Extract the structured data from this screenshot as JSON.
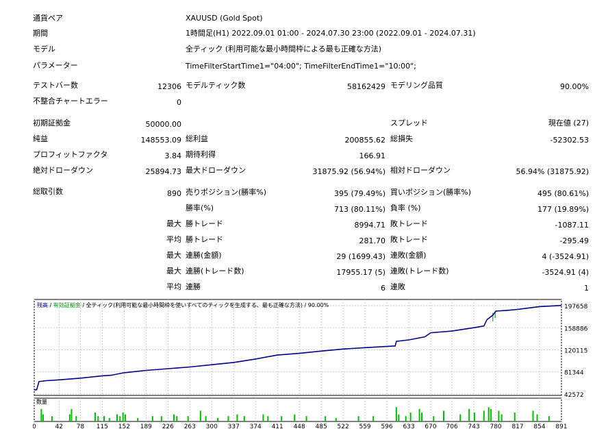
{
  "header": {
    "symbol_label": "通貨ペア",
    "symbol_value": "XAUUSD (Gold Spot)",
    "period_label": "期間",
    "period_value": "1時間足(H1) 2022.09.01 01:00 - 2024.07.30 23:00 (2022.09.01 - 2024.07.31)",
    "model_label": "モデル",
    "model_value": "全ティック (利用可能な最小時間枠による最も正確な方法)",
    "params_label": "パラメーター",
    "params_value": "TimeFilterStartTime1=\"04:00\"; TimeFilterEndTime1=\"10:00\";"
  },
  "stats": {
    "bars_label": "テストバー数",
    "bars_value": "12306",
    "ticks_label": "モデルティック数",
    "ticks_value": "58162429",
    "quality_label": "モデリング品質",
    "quality_value": "90.00%",
    "mismatch_label": "不整合チャートエラー",
    "mismatch_value": "0",
    "deposit_label": "初期証拠金",
    "deposit_value": "50000.00",
    "spread_label": "スプレッド",
    "spread_value": "現在値 (27)",
    "net_label": "純益",
    "net_value": "148553.09",
    "gross_profit_label": "総利益",
    "gross_profit_value": "200855.62",
    "gross_loss_label": "総損失",
    "gross_loss_value": "-52302.53",
    "pf_label": "プロフィットファクタ",
    "pf_value": "3.84",
    "expected_label": "期待利得",
    "expected_value": "166.91",
    "abs_dd_label": "絶対ドローダウン",
    "abs_dd_value": "25894.73",
    "max_dd_label": "最大ドローダウン",
    "max_dd_value": "31875.92 (56.94%)",
    "rel_dd_label": "相対ドローダウン",
    "rel_dd_value": "56.94% (31875.92)",
    "trades_label": "総取引数",
    "trades_value": "890",
    "short_label": "売りポジション(勝率%)",
    "short_value": "395 (79.49%)",
    "long_label": "買いポジション(勝率%)",
    "long_value": "495 (80.61%)",
    "win_rate_label": "勝率(%)",
    "win_rate_value": "713 (80.11%)",
    "loss_rate_label": "負率 (%)",
    "loss_rate_value": "177 (19.89%)",
    "max_prefix": "最大",
    "avg_prefix": "平均",
    "win_trade_label": "勝トレード",
    "loss_trade_label": "敗トレード",
    "largest_win_value": "8994.71",
    "largest_loss_value": "-1087.11",
    "avg_win_value": "281.70",
    "avg_loss_value": "-295.49",
    "max_cons_amount_label": "連勝(金額)",
    "max_cons_amount_value": "29 (1699.43)",
    "max_cons_loss_amount_label": "連敗(金額)",
    "max_cons_loss_amount_value": "4 (-3524.91)",
    "max_cons_trades_label": "連勝(トレード数)",
    "max_cons_trades_value": "17955.17 (5)",
    "max_cons_loss_trades_label": "連敗(トレード数)",
    "max_cons_loss_trades_value": "-3524.91 (4)",
    "avg_cons_win_label": "連勝",
    "avg_cons_win_value": "6",
    "avg_cons_loss_label": "連敗",
    "avg_cons_loss_value": "1"
  },
  "chart_data": {
    "type": "line",
    "legend": [
      "残高",
      "有効証拠金",
      "全ティック(利用可能な最小時間枠を使いすべてのティックを生成する、最も正確な方法)",
      "90.00%"
    ],
    "legend_colors": [
      "#00008b",
      "#00a000",
      "#000000",
      "#000000"
    ],
    "sub_label": "数量",
    "y_ticks": [
      197658,
      158886,
      120115,
      81344,
      42572
    ],
    "x_ticks": [
      0,
      42,
      78,
      115,
      152,
      189,
      226,
      263,
      300,
      337,
      374,
      411,
      448,
      485,
      522,
      559,
      596,
      633,
      670,
      706,
      743,
      780,
      817,
      854,
      891
    ],
    "xlim": [
      0,
      891
    ],
    "ylim": [
      42572,
      197658
    ],
    "balance_color": "#00008b",
    "equity_color": "#00c000",
    "balance": [
      [
        0,
        50000
      ],
      [
        4,
        50000
      ],
      [
        8,
        64500
      ],
      [
        20,
        66000
      ],
      [
        42,
        67500
      ],
      [
        78,
        70500
      ],
      [
        115,
        74500
      ],
      [
        130,
        75500
      ],
      [
        140,
        77500
      ],
      [
        152,
        80000
      ],
      [
        189,
        84000
      ],
      [
        226,
        87000
      ],
      [
        263,
        90000
      ],
      [
        300,
        94000
      ],
      [
        337,
        98000
      ],
      [
        374,
        104000
      ],
      [
        411,
        111000
      ],
      [
        448,
        114000
      ],
      [
        485,
        118000
      ],
      [
        522,
        121500
      ],
      [
        559,
        124000
      ],
      [
        610,
        127000
      ],
      [
        612,
        135000
      ],
      [
        633,
        137500
      ],
      [
        660,
        143000
      ],
      [
        670,
        150000
      ],
      [
        706,
        153000
      ],
      [
        743,
        159000
      ],
      [
        760,
        162000
      ],
      [
        765,
        173000
      ],
      [
        775,
        181000
      ],
      [
        780,
        188000
      ],
      [
        800,
        189500
      ],
      [
        817,
        191000
      ],
      [
        854,
        196000
      ],
      [
        891,
        198000
      ]
    ],
    "equity_dips": [
      [
        775,
        185000,
        170000
      ],
      [
        779,
        187000,
        176000
      ]
    ],
    "volume": [
      [
        12,
        0.7
      ],
      [
        15,
        0.4
      ],
      [
        30,
        0.3
      ],
      [
        60,
        0.4
      ],
      [
        63,
        0.7
      ],
      [
        71,
        0.3
      ],
      [
        103,
        0.5
      ],
      [
        108,
        0.3
      ],
      [
        118,
        0.3
      ],
      [
        127,
        0.2
      ],
      [
        140,
        0.4
      ],
      [
        145,
        0.3
      ],
      [
        150,
        0.5
      ],
      [
        154,
        0.4
      ],
      [
        175,
        0.2
      ],
      [
        200,
        0.3
      ],
      [
        215,
        0.3
      ],
      [
        236,
        0.4
      ],
      [
        241,
        0.3
      ],
      [
        260,
        0.3
      ],
      [
        281,
        0.6
      ],
      [
        290,
        0.3
      ],
      [
        310,
        0.2
      ],
      [
        328,
        0.3
      ],
      [
        343,
        0.4
      ],
      [
        355,
        0.3
      ],
      [
        387,
        0.4
      ],
      [
        395,
        0.3
      ],
      [
        418,
        0.3
      ],
      [
        440,
        0.4
      ],
      [
        460,
        0.3
      ],
      [
        492,
        0.3
      ],
      [
        510,
        0.2
      ],
      [
        548,
        0.3
      ],
      [
        573,
        0.3
      ],
      [
        612,
        0.8
      ],
      [
        616,
        0.4
      ],
      [
        628,
        0.3
      ],
      [
        636,
        0.5
      ],
      [
        651,
        0.7
      ],
      [
        655,
        0.5
      ],
      [
        675,
        0.3
      ],
      [
        692,
        0.6
      ],
      [
        720,
        0.4
      ],
      [
        735,
        0.7
      ],
      [
        744,
        0.5
      ],
      [
        760,
        0.6
      ],
      [
        768,
        0.8
      ],
      [
        772,
        0.7
      ],
      [
        785,
        0.6
      ],
      [
        790,
        0.4
      ],
      [
        812,
        0.5
      ],
      [
        843,
        0.6
      ],
      [
        850,
        0.4
      ],
      [
        870,
        0.3
      ]
    ]
  }
}
